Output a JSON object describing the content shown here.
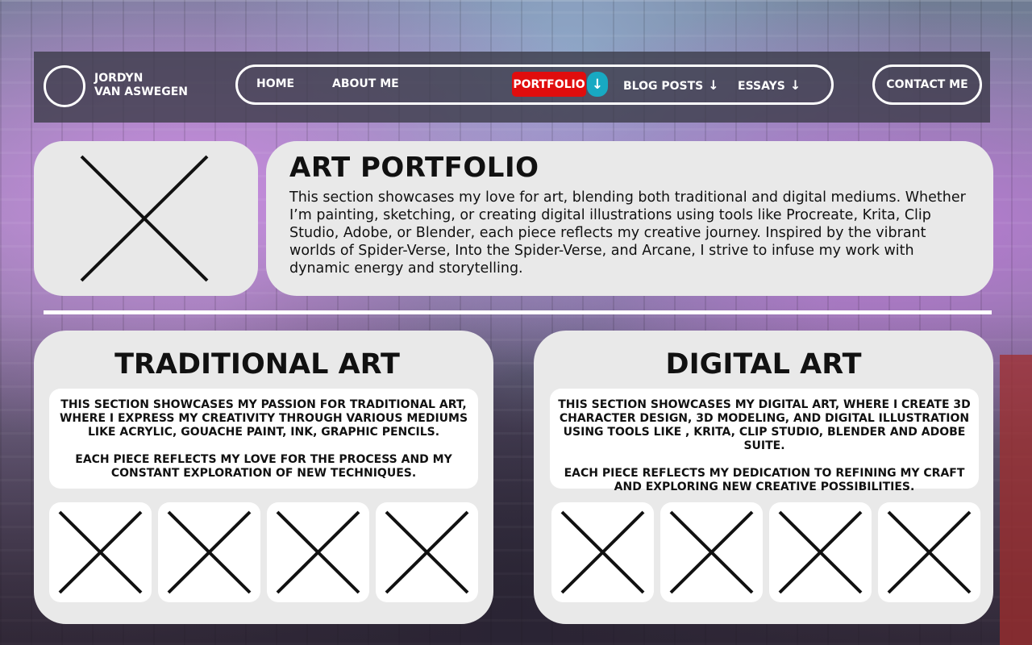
{
  "brand": {
    "line1": "JORDYN",
    "line2": "VAN ASWEGEN"
  },
  "nav": {
    "home": "HOME",
    "about": "ABOUT ME",
    "portfolio": "PORTFOLIO",
    "blog": "BLOG POSTS",
    "essays": "ESSAYS",
    "arrow": "↓",
    "active": "PORTFOLIO",
    "active_color": "#e00d0d",
    "arrow_badge_color": "#18a9c2"
  },
  "contact": {
    "label": "CONTACT ME"
  },
  "hero": {
    "title": "ART PORTFOLIO",
    "body": "This section showcases my love for art, blending both traditional and digital mediums. Whether I’m painting, sketching, or creating digital illustrations using tools like Procreate, Krita, Clip Studio, Adobe, or Blender, each piece reflects my creative journey. Inspired by the vibrant worlds of Spider-Verse, Into the Spider-Verse, and Arcane, I strive to infuse my work with dynamic energy and storytelling."
  },
  "traditional": {
    "title": "TRADITIONAL ART",
    "desc1": "THIS SECTION SHOWCASES MY PASSION FOR TRADITIONAL ART, WHERE I EXPRESS MY CREATIVITY THROUGH VARIOUS MEDIUMS LIKE ACRYLIC, GOUACHE PAINT, INK, GRAPHIC PENCILS.",
    "desc2": "EACH PIECE REFLECTS MY LOVE FOR THE PROCESS AND MY CONSTANT EXPLORATION OF NEW TECHNIQUES."
  },
  "digital": {
    "title": "DIGITAL ART",
    "desc1": "THIS SECTION SHOWCASES MY DIGITAL ART, WHERE I CREATE 3D CHARACTER DESIGN, 3D MODELING, AND DIGITAL ILLUSTRATION USING TOOLS LIKE , KRITA, CLIP STUDIO, BLENDER AND ADOBE SUITE.",
    "desc2": "EACH PIECE REFLECTS MY DEDICATION TO REFINING MY CRAFT AND EXPLORING NEW CREATIVE POSSIBILITIES."
  },
  "icons": {
    "placeholder": "x-placeholder-icon",
    "dropdown": "arrow-down-icon"
  }
}
